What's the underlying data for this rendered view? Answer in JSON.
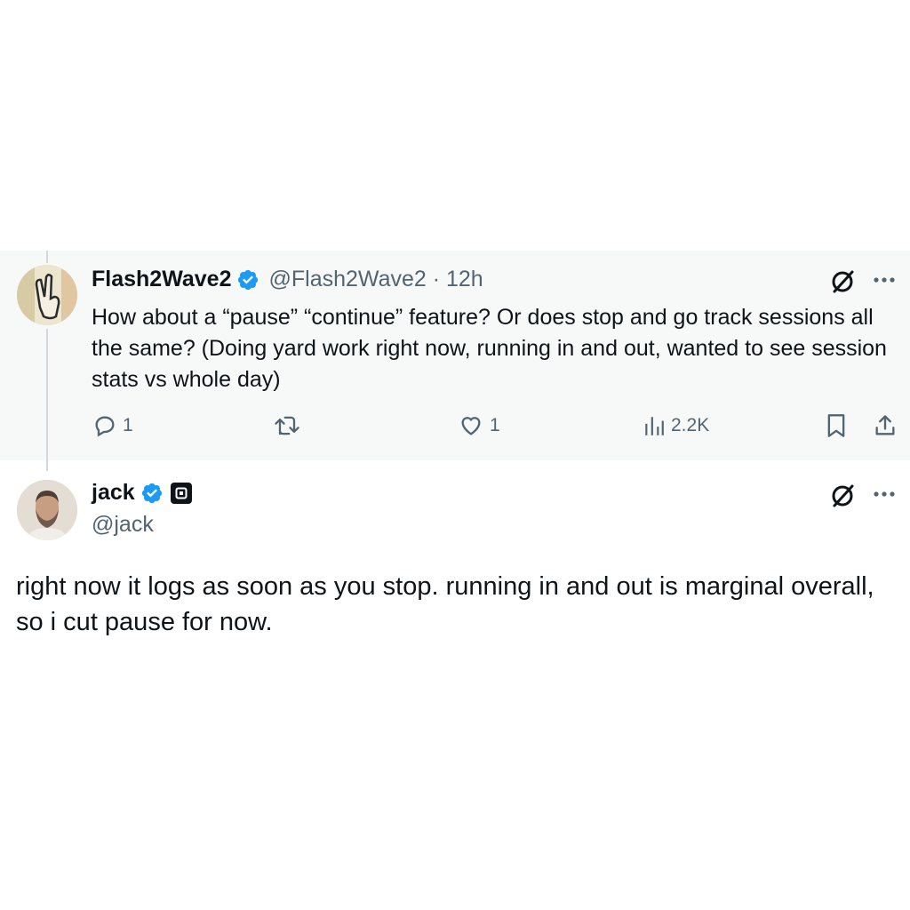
{
  "reply_tweet": {
    "display_name": "Flash2Wave2",
    "handle_and_time": "@Flash2Wave2 · 12h",
    "text": "How about a “pause” “continue” feature? Or does stop and go track sessions all the same? (Doing yard work right now, running in and out, wanted to see session stats vs whole day)",
    "counts": {
      "replies": "1",
      "likes": "1",
      "views": "2.2K"
    }
  },
  "main_tweet": {
    "display_name": "jack",
    "handle": "@jack",
    "text": "right now it logs as soon as you stop. running in and out is marginal overall, so i cut pause for now."
  },
  "colors": {
    "verified": "#1d9bf0",
    "secondary_text": "#536471",
    "primary_text": "#0f1419"
  },
  "icons": [
    "grok-icon",
    "more-icon",
    "reply-icon",
    "retweet-icon",
    "like-icon",
    "views-icon",
    "bookmark-icon",
    "share-icon",
    "verified-icon",
    "square-badge-icon"
  ]
}
